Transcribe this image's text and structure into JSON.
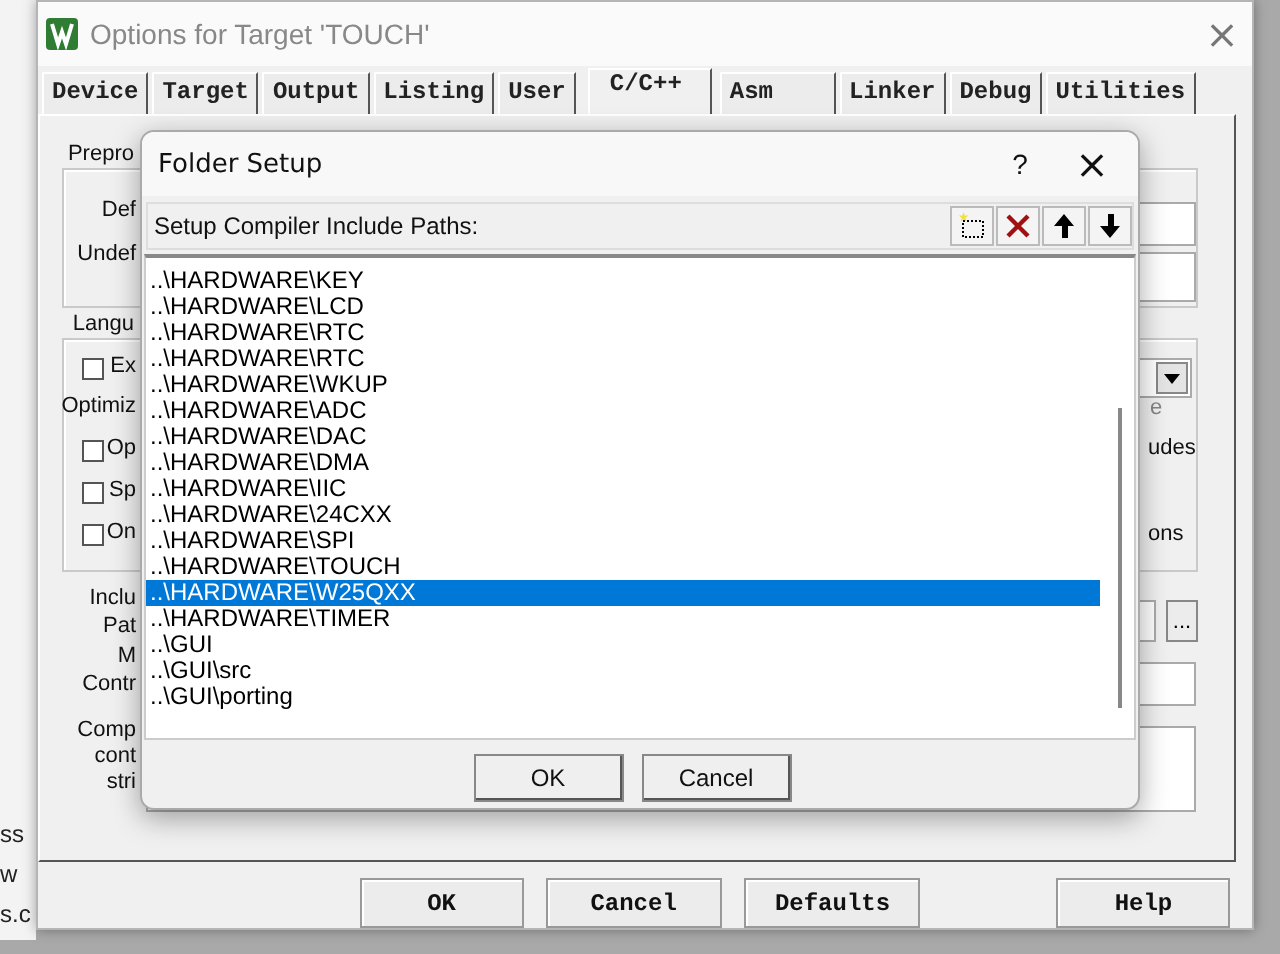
{
  "window": {
    "title": "Options for Target 'TOUCH'",
    "close": "×"
  },
  "tabs": [
    {
      "label": "Device",
      "selected": false
    },
    {
      "label": "Target",
      "selected": false
    },
    {
      "label": "Output",
      "selected": false
    },
    {
      "label": "Listing",
      "selected": false
    },
    {
      "label": "User",
      "selected": false
    },
    {
      "label": "C/C++",
      "selected": true
    },
    {
      "label": "Asm",
      "selected": false
    },
    {
      "label": "Linker",
      "selected": false
    },
    {
      "label": "Debug",
      "selected": false
    },
    {
      "label": "Utilities",
      "selected": false
    }
  ],
  "options_panel": {
    "items": [
      {
        "kind": "group",
        "text": "Prepro",
        "disabled": false
      },
      {
        "kind": "label",
        "text": "Def",
        "disabled": false
      },
      {
        "kind": "label",
        "text": "Undef",
        "disabled": false
      },
      {
        "kind": "group",
        "text": "Langu",
        "disabled": false
      },
      {
        "kind": "checkbox",
        "text": "Ex",
        "checked": false,
        "disabled": false
      },
      {
        "kind": "label",
        "text": "Optimiz",
        "disabled": false
      },
      {
        "kind": "checkbox",
        "text": "Op",
        "checked": false,
        "disabled": false
      },
      {
        "kind": "checkbox",
        "text": "Sp",
        "checked": false,
        "disabled": false
      },
      {
        "kind": "checkbox",
        "text": "On",
        "checked": false,
        "disabled": false
      },
      {
        "kind": "label",
        "text": "Inclu",
        "disabled": false
      },
      {
        "kind": "label",
        "text": "Pat",
        "disabled": false
      },
      {
        "kind": "label",
        "text": "M",
        "disabled": false
      },
      {
        "kind": "label",
        "text": "Contr",
        "disabled": false
      },
      {
        "kind": "label",
        "text": "Comp",
        "disabled": false
      },
      {
        "kind": "label",
        "text": "cont",
        "disabled": false
      },
      {
        "kind": "label",
        "text": "stri",
        "disabled": false
      },
      {
        "kind": "label",
        "text": "e",
        "disabled": true
      },
      {
        "kind": "label",
        "text": "udes",
        "disabled": false
      },
      {
        "kind": "label",
        "text": "ons",
        "disabled": false
      },
      {
        "kind": "browse",
        "text": "...",
        "disabled": false
      }
    ]
  },
  "buttons": [
    "OK",
    "Cancel",
    "Defaults",
    "Help"
  ],
  "dialog": {
    "title": "Folder Setup",
    "help": "?",
    "close": "×",
    "list_label": "Setup Compiler Include Paths:",
    "paths": [
      {
        "text": "..\\HARDWARE\\KEY",
        "selected": false
      },
      {
        "text": "..\\HARDWARE\\LCD",
        "selected": false
      },
      {
        "text": "..\\HARDWARE\\RTC",
        "selected": false
      },
      {
        "text": "..\\HARDWARE\\RTC",
        "selected": false
      },
      {
        "text": "..\\HARDWARE\\WKUP",
        "selected": false
      },
      {
        "text": "..\\HARDWARE\\ADC",
        "selected": false
      },
      {
        "text": "..\\HARDWARE\\DAC",
        "selected": false
      },
      {
        "text": "..\\HARDWARE\\DMA",
        "selected": false
      },
      {
        "text": "..\\HARDWARE\\IIC",
        "selected": false
      },
      {
        "text": "..\\HARDWARE\\24CXX",
        "selected": false
      },
      {
        "text": "..\\HARDWARE\\SPI",
        "selected": false
      },
      {
        "text": "..\\HARDWARE\\TOUCH",
        "selected": false
      },
      {
        "text": "..\\HARDWARE\\W25QXX",
        "selected": true
      },
      {
        "text": "..\\HARDWARE\\TIMER",
        "selected": false
      },
      {
        "text": "..\\GUI",
        "selected": false
      },
      {
        "text": "..\\GUI\\src",
        "selected": false
      },
      {
        "text": "..\\GUI\\porting",
        "selected": false
      }
    ],
    "buttons": [
      "OK",
      "Cancel"
    ]
  },
  "desktop_fragments": [
    "ss",
    "w",
    "s.c"
  ]
}
